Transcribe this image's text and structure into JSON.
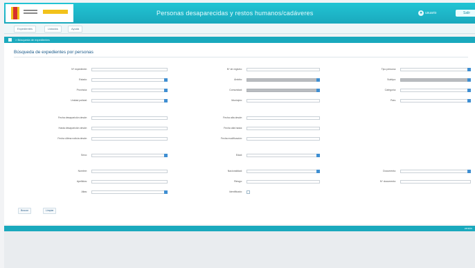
{
  "header": {
    "app_title": "Personas desaparecidas y restos humanos/cadáveres",
    "user_name": "usuario",
    "logout_label": "Salir"
  },
  "menu": {
    "items": [
      "Expedientes",
      "Listados",
      "Ayuda"
    ]
  },
  "breadcrumb": {
    "text": "> Búsqueda de expedientes"
  },
  "page": {
    "title": "Búsqueda de expedientes por personas"
  },
  "form": {
    "col1": {
      "numero_expediente": "Nº expediente:",
      "estado": "Estado:",
      "provincia": "Provincia:",
      "unidad": "Unidad policial:",
      "fecha_desde": "Fecha desaparición desde:",
      "fecha_hasta": "Hasta desaparición desde:",
      "fecha_ult": "Fecha última noticia desde:",
      "sexo": "Sexo:",
      "nombre": "Nombre:",
      "apellidos": "Apellidos:",
      "alias": "Alias:"
    },
    "col2": {
      "tipo": "Nº de registro:",
      "ambito": "Ámbito:",
      "comunidad": "Comunidad:",
      "municipio": "Municipio:",
      "fecha_alta_desde": "Fecha alta desde:",
      "fecha_alta_hasta": "Fecha alta hasta:",
      "fecha_mod": "Fecha modificación:",
      "edad": "Edad:",
      "nacionalidad": "Nacionalidad:",
      "riesgo": "Riesgo:",
      "identificado": "Identificado:"
    },
    "col3": {
      "tipo_persona": "Tipo persona:",
      "subtipo": "Subtipo:",
      "categoria": "Categoría:",
      "pais": "País:",
      "documento": "Documento:",
      "numero_doc": "Nº documento:"
    }
  },
  "buttons": {
    "search": "Buscar",
    "clear": "Limpiar"
  },
  "footer": {
    "text": "versión"
  }
}
